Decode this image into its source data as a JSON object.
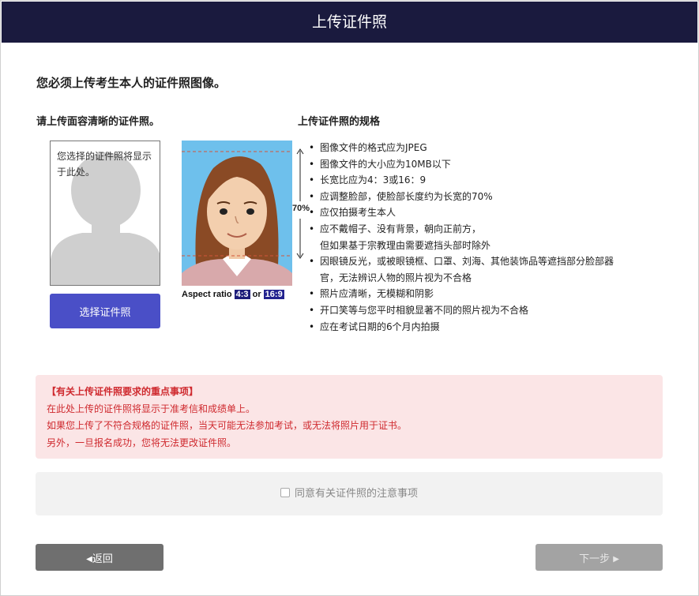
{
  "header": {
    "title": "上传证件照"
  },
  "main": {
    "heading": "您必须上传考生本人的证件照图像。",
    "left_subheading": "请上传面容清晰的证件照。",
    "right_subheading": "上传证件照的规格",
    "preview_text": "您选择的证件照将显示于此处。",
    "choose_button": "选择证件照",
    "sample": {
      "percent_label": "70%",
      "aspect_prefix": "Aspect ratio",
      "aspect_a": "4:3",
      "aspect_or": "or",
      "aspect_b": "16:9"
    },
    "specs": [
      "图像文件的格式应为JPEG",
      "图像文件的大小应为10MB以下",
      "长宽比应为4：3或16：9",
      "应调整脸部，使脸部长度约为长宽的70%",
      "应仅拍摄考生本人",
      "应不戴帽子、没有背景，朝向正前方，",
      "但如果基于宗教理由需要遮挡头部时除外",
      "因眼镜反光，或被眼镜框、口罩、刘海、其他装饰品等遮挡部分脸部器",
      "官，无法辨识人物的照片视为不合格",
      "照片应清晰，无模糊和阴影",
      "开口笑等与您平时相貌显著不同的照片视为不合格",
      "应在考试日期的6个月内拍摄"
    ]
  },
  "notice": {
    "title": "【有关上传证件照要求的重点事项】",
    "line1": "在此处上传的证件照将显示于准考信和成绩单上。",
    "line2": "如果您上传了不符合规格的证件照，当天可能无法参加考试，或无法将照片用于证书。",
    "line3": "另外，一旦报名成功，您将无法更改证件照。"
  },
  "agree": {
    "label": "同意有关证件照的注意事项"
  },
  "footer": {
    "back_label": "返回",
    "next_label": "下一步"
  }
}
